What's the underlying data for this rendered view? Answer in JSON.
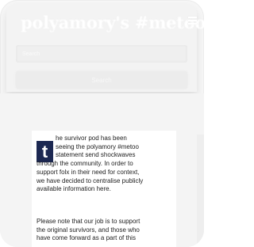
{
  "header": {
    "site_title": "polyamory's #metoo",
    "menu_icon": "hamburger-menu-icon",
    "search_placeholder": "Search",
    "search_button_label": "Search"
  },
  "article": {
    "dropcap_letter": "t",
    "paragraph1_lines": [
      "he survivor pod has been",
      "seeing the polyamory #metoo",
      "statement send shockwaves",
      "through the community. In order to",
      "support folx in their need for context,",
      "we have decided to centralise publicly",
      "available information here."
    ],
    "paragraph2_lines": [
      "Please note that our job is to support",
      "the original survivors, and those who",
      "have come forward as a part of this"
    ]
  },
  "colors": {
    "dropcap_bg": "#1c2852",
    "header_bg": "#f3f3f3",
    "page_bg": "#f4f4f4"
  }
}
